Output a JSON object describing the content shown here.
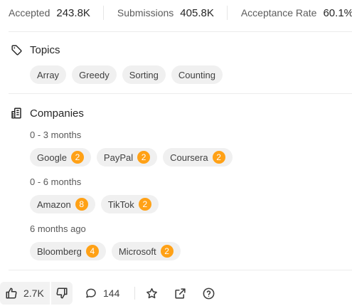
{
  "stats": [
    {
      "label": "Accepted",
      "value": "243.8K"
    },
    {
      "label": "Submissions",
      "value": "405.8K"
    },
    {
      "label": "Acceptance Rate",
      "value": "60.1%"
    }
  ],
  "topics": {
    "title": "Topics",
    "icon": "tag-icon",
    "tags": [
      "Array",
      "Greedy",
      "Sorting",
      "Counting"
    ]
  },
  "companies": {
    "title": "Companies",
    "icon": "building-icon",
    "accent_color": "#ffa116",
    "groups": [
      {
        "range": "0 - 3 months",
        "items": [
          {
            "name": "Google",
            "count": "2"
          },
          {
            "name": "PayPal",
            "count": "2"
          },
          {
            "name": "Coursera",
            "count": "2"
          }
        ]
      },
      {
        "range": "0 - 6 months",
        "items": [
          {
            "name": "Amazon",
            "count": "8"
          },
          {
            "name": "TikTok",
            "count": "2"
          }
        ]
      },
      {
        "range": "6 months ago",
        "items": [
          {
            "name": "Bloomberg",
            "count": "4"
          },
          {
            "name": "Microsoft",
            "count": "2"
          }
        ]
      }
    ]
  },
  "footer": {
    "likes": "2.7K",
    "comments": "144",
    "icons": [
      "thumbs-up-icon",
      "thumbs-down-icon",
      "comment-icon",
      "star-icon",
      "share-icon",
      "help-icon"
    ]
  }
}
